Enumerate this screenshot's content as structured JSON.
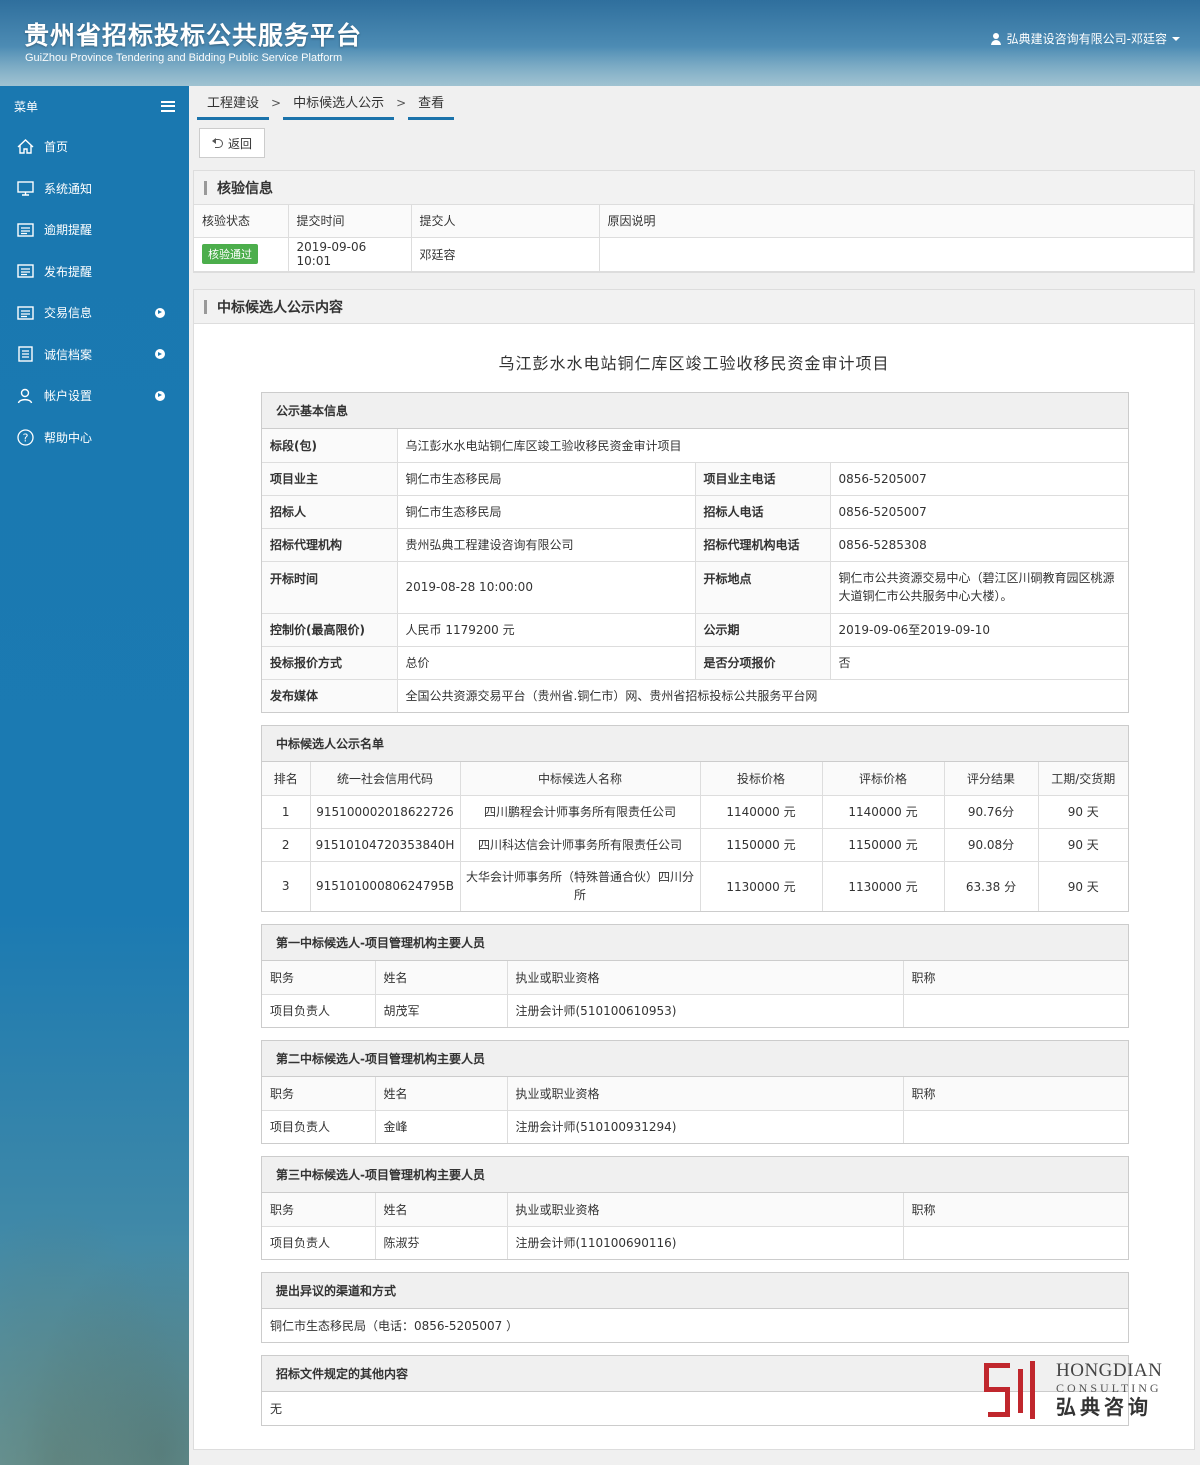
{
  "header": {
    "title_cn": "贵州省招标投标公共服务平台",
    "title_en": "GuiZhou Province Tendering and Bidding Public Service Platform",
    "user": "弘典建设咨询有限公司-邓廷容"
  },
  "sidebar": {
    "menu_label": "菜单",
    "items": [
      {
        "label": "首页",
        "icon": "home-icon"
      },
      {
        "label": "系统通知",
        "icon": "monitor-icon"
      },
      {
        "label": "逾期提醒",
        "icon": "list-icon"
      },
      {
        "label": "发布提醒",
        "icon": "list-icon"
      },
      {
        "label": "交易信息",
        "icon": "list-icon"
      },
      {
        "label": "诚信档案",
        "icon": "document-icon"
      },
      {
        "label": "帐户设置",
        "icon": "user-icon"
      },
      {
        "label": "帮助中心",
        "icon": "help-icon"
      }
    ]
  },
  "breadcrumb": [
    "工程建设",
    "中标候选人公示",
    "查看"
  ],
  "back_label": "返回",
  "verify": {
    "title": "核验信息",
    "headers": [
      "核验状态",
      "提交时间",
      "提交人",
      "原因说明"
    ],
    "status": "核验通过",
    "time": "2019-09-06 10:01",
    "submitter": "邓廷容",
    "reason": ""
  },
  "content": {
    "title": "中标候选人公示内容",
    "project_title": "乌江彭水水电站铜仁库区竣工验收移民资金审计项目",
    "basic": {
      "title": "公示基本信息",
      "section_label": "标段(包)",
      "section_value": "乌江彭水水电站铜仁库区竣工验收移民资金审计项目",
      "owner_label": "项目业主",
      "owner_value": "铜仁市生态移民局",
      "owner_phone_label": "项目业主电话",
      "owner_phone_value": "0856-5205007",
      "tenderer_label": "招标人",
      "tenderer_value": "铜仁市生态移民局",
      "tenderer_phone_label": "招标人电话",
      "tenderer_phone_value": "0856-5205007",
      "agent_label": "招标代理机构",
      "agent_value": "贵州弘典工程建设咨询有限公司",
      "agent_phone_label": "招标代理机构电话",
      "agent_phone_value": "0856-5285308",
      "open_time_label": "开标时间",
      "open_time_value": "2019-08-28 10:00:00",
      "open_place_label": "开标地点",
      "open_place_value": "铜仁市公共资源交易中心（碧江区川硐教育园区桃源大道铜仁市公共服务中心大楼）。",
      "price_limit_label": "控制价(最高限价)",
      "price_limit_value": "人民币 1179200 元",
      "period_label": "公示期",
      "period_value": "2019-09-06至2019-09-10",
      "quote_mode_label": "投标报价方式",
      "quote_mode_value": "总价",
      "split_label": "是否分项报价",
      "split_value": "否",
      "media_label": "发布媒体",
      "media_value": "全国公共资源交易平台（贵州省.铜仁市）网、贵州省招标投标公共服务平台网"
    },
    "candidates": {
      "title": "中标候选人公示名单",
      "headers": [
        "排名",
        "统一社会信用代码",
        "中标候选人名称",
        "投标价格",
        "评标价格",
        "评分结果",
        "工期/交货期"
      ],
      "rows": [
        {
          "rank": "1",
          "code": "915100002018622726",
          "name": "四川鹏程会计师事务所有限责任公司",
          "bid": "1140000 元",
          "eval": "1140000 元",
          "score": "90.76分",
          "period": "90 天"
        },
        {
          "rank": "2",
          "code": "91510104720353840H",
          "name": "四川科达信会计师事务所有限责任公司",
          "bid": "1150000 元",
          "eval": "1150000 元",
          "score": "90.08分",
          "period": "90 天"
        },
        {
          "rank": "3",
          "code": "91510100080624795B",
          "name": "大华会计师事务所（特殊普通合伙）四川分所",
          "bid": "1130000 元",
          "eval": "1130000 元",
          "score": "63.38 分",
          "period": "90 天"
        }
      ]
    },
    "staff_headers": [
      "职务",
      "姓名",
      "执业或职业资格",
      "职称"
    ],
    "staff": [
      {
        "title": "第一中标候选人-项目管理机构主要人员",
        "role": "项目负责人",
        "name": "胡茂军",
        "qual": "注册会计师(510100610953)",
        "rank": ""
      },
      {
        "title": "第二中标候选人-项目管理机构主要人员",
        "role": "项目负责人",
        "name": "金峰",
        "qual": "注册会计师(510100931294)",
        "rank": ""
      },
      {
        "title": "第三中标候选人-项目管理机构主要人员",
        "role": "项目负责人",
        "name": "陈淑芬",
        "qual": "注册会计师(110100690116)",
        "rank": ""
      }
    ],
    "objection": {
      "title": "提出异议的渠道和方式",
      "text": "铜仁市生态移民局（电话：0856-5205007 ）"
    },
    "other": {
      "title": "招标文件规定的其他内容",
      "text": "无"
    }
  },
  "watermark": {
    "en1": "HONGDIAN",
    "en2": "CONSULTING",
    "cn": "弘典咨询",
    "color": "#c0272d"
  }
}
